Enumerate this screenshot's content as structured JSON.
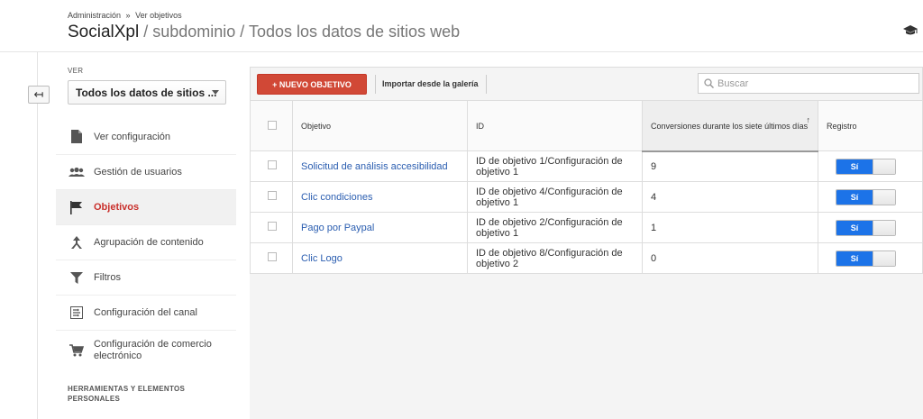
{
  "breadcrumb": {
    "item1": "Administración",
    "sep": "»",
    "item2": "Ver objetivos"
  },
  "header": {
    "account": "SocialXpl",
    "path": " / subdominio / Todos los datos de sitios web"
  },
  "sidebar": {
    "view_label": "VER",
    "view_selected": "Todos los datos de sitios ...",
    "items": [
      {
        "label": "Ver configuración",
        "icon": "document-icon"
      },
      {
        "label": "Gestión de usuarios",
        "icon": "users-icon"
      },
      {
        "label": "Objetivos",
        "icon": "flag-icon",
        "active": true
      },
      {
        "label": "Agrupación de contenido",
        "icon": "grouping-icon"
      },
      {
        "label": "Filtros",
        "icon": "filter-icon"
      },
      {
        "label": "Configuración del canal",
        "icon": "channel-icon"
      },
      {
        "label": "Configuración de comercio electrónico",
        "icon": "cart-icon"
      }
    ],
    "section_label": "HERRAMIENTAS Y ELEMENTOS PERSONALES"
  },
  "toolbar": {
    "new_goal_label": "+ NUEVO OBJETIVO",
    "import_label": "Importar desde la galería",
    "search_placeholder": "Buscar"
  },
  "table": {
    "headers": {
      "goal": "Objetivo",
      "id": "ID",
      "conversions": "Conversiones durante los siete últimos días",
      "sort_indicator": "↑",
      "recording": "Registro"
    },
    "rows": [
      {
        "goal": "Solicitud de análisis accesibilidad",
        "id": "ID de objetivo 1/Configuración de objetivo 1",
        "conversions": "9",
        "recording": "Sí"
      },
      {
        "goal": "Clic condiciones",
        "id": "ID de objetivo 4/Configuración de objetivo 1",
        "conversions": "4",
        "recording": "Sí"
      },
      {
        "goal": "Pago por Paypal",
        "id": "ID de objetivo 2/Configuración de objetivo 1",
        "conversions": "1",
        "recording": "Sí"
      },
      {
        "goal": "Clic Logo",
        "id": "ID de objetivo 8/Configuración de objetivo 2",
        "conversions": "0",
        "recording": "Sí"
      }
    ]
  },
  "colors": {
    "accent_red": "#d14836",
    "toggle_blue": "#1c73e8",
    "link_blue": "#2a5db0",
    "active_nav": "#c9302c"
  }
}
